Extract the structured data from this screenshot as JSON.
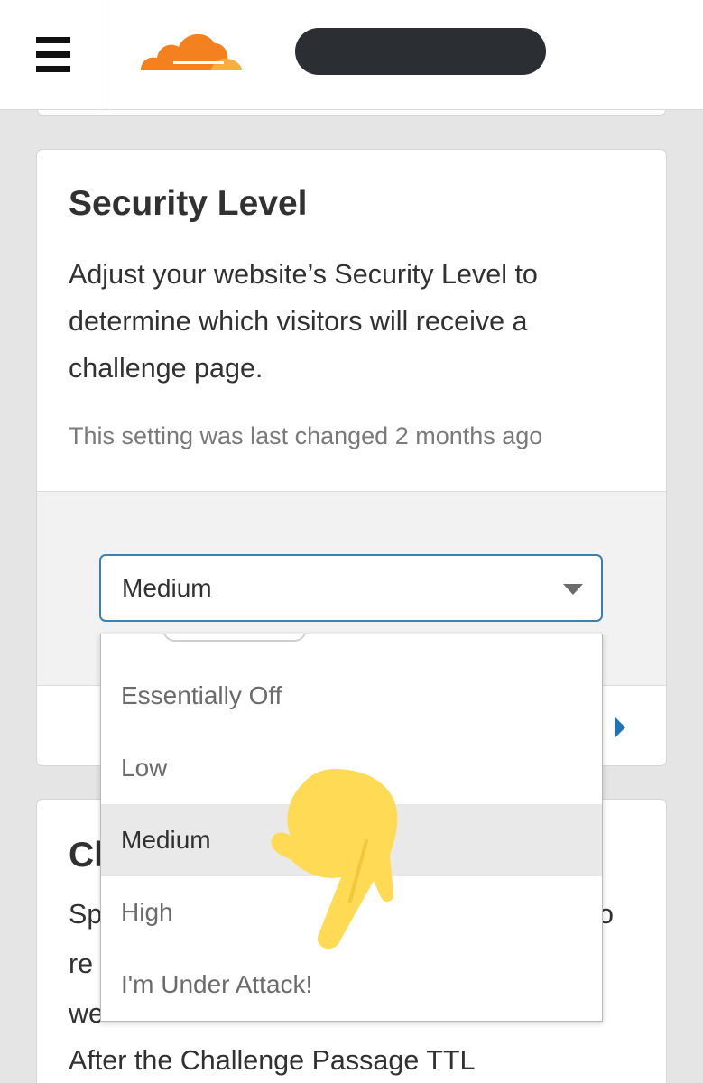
{
  "header": {
    "menu_icon": "hamburger-menu-icon",
    "logo_icon": "cloudflare-logo",
    "account_name": ""
  },
  "security_card": {
    "title": "Security Level",
    "description": "Adjust your website’s Security Level to determine which visitors will receive a challenge page.",
    "last_changed": "This setting was last changed 2 months ago",
    "select": {
      "value": "Medium",
      "options": [
        "Essentially Off",
        "Low",
        "Medium",
        "High",
        "I'm Under Attack!"
      ],
      "highlighted": "Medium"
    },
    "help_icon": "caret-right-icon"
  },
  "next_card": {
    "title_partial": "Cl",
    "line1_partial": "Sp",
    "line1_end": "o",
    "line2_partial": "re",
    "line3_partial": "we",
    "line4": "After the Challenge Passage TTL"
  },
  "overlay": {
    "pointer_icon": "pointing-finger-emoji",
    "pointer_color": "#FFDA55"
  },
  "colors": {
    "accent": "#3B7FB3",
    "brand_orange": "#F48120",
    "brand_light_orange": "#FAAD3F"
  }
}
